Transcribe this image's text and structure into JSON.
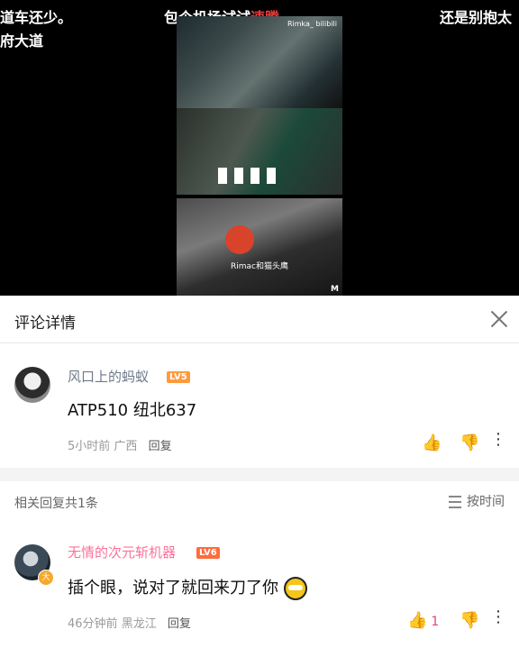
{
  "video": {
    "danmaku": [
      "道车还少。",
      "包个机场试试",
      "速腾",
      "还是别抱太",
      "府大道"
    ],
    "watermark": "Rimka_ bilibili",
    "subtitle": "Rimac和猫头鹰",
    "m_logo": "M"
  },
  "sheet": {
    "title": "评论详情",
    "comment": {
      "username": "风口上的蚂蚁",
      "level": "LV5",
      "text": "ATP510  纽北637",
      "time": "5小时前",
      "location": "广西",
      "reply_label": "回复"
    },
    "replies_count": "相关回复共1条",
    "sort_label": "按时间",
    "reply": {
      "username": "无情的次元斩机器",
      "level": "LV6",
      "text": "插个眼，说对了就回来刀了你",
      "time": "46分钟前",
      "location": "黑龙江",
      "reply_label": "回复",
      "likes": "1",
      "avatar_badge": "大"
    },
    "colors": {
      "username": "#6d7a8a",
      "accent": "#fb7299",
      "lv5": "#ff9a3c",
      "lv6": "#ff6b3c"
    }
  }
}
